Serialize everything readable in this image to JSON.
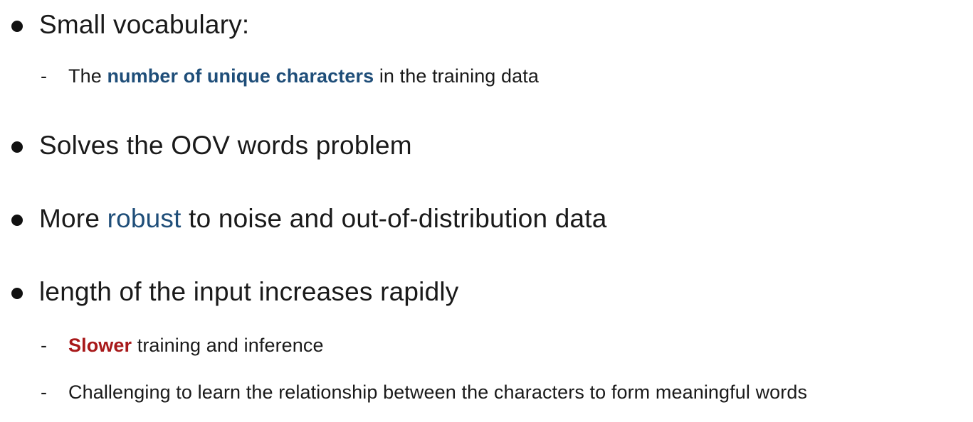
{
  "bullets": [
    {
      "text": "Small vocabulary:",
      "subs": [
        {
          "before": "The ",
          "highlight": "number of unique characters",
          "after": " in the training data"
        }
      ]
    },
    {
      "text": "Solves the OOV words problem"
    },
    {
      "before": "More ",
      "highlight": "robust",
      "after": " to noise and out-of-distribution data"
    },
    {
      "text": "length of the input increases rapidly",
      "subs": [
        {
          "highlight": "Slower",
          "after": " training and inference"
        },
        {
          "text": "Challenging to learn the relationship between the characters to form meaningful words"
        }
      ]
    }
  ],
  "dash": "-",
  "colors": {
    "highlight_blue": "#1f4e79",
    "highlight_red": "#a8191a",
    "text": "#1a1a1a"
  }
}
